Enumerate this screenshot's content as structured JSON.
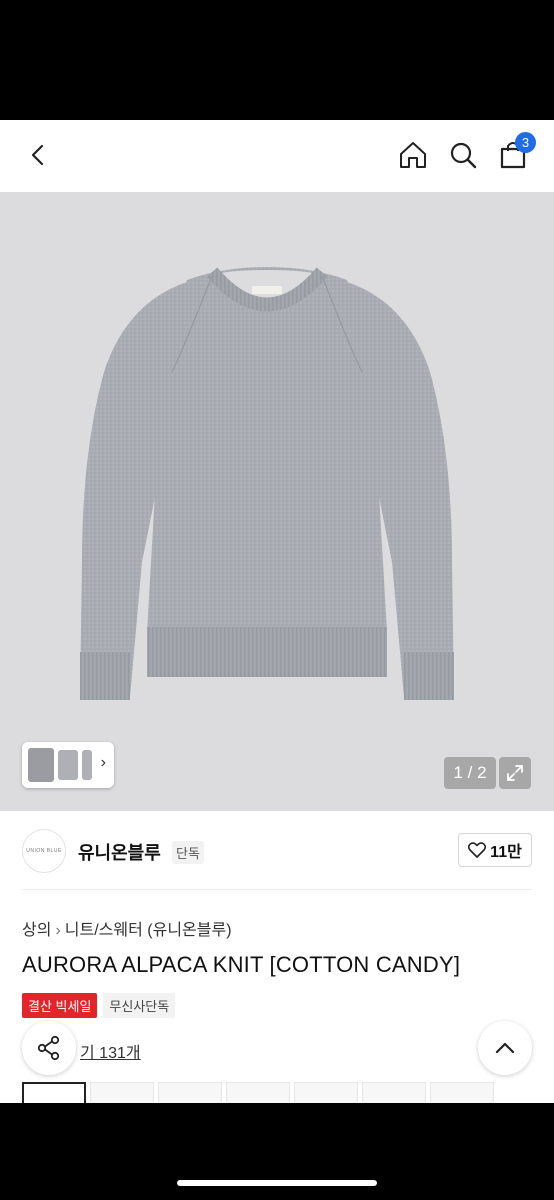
{
  "header": {
    "cart_count": "3"
  },
  "gallery": {
    "counter": "1 / 2"
  },
  "brand": {
    "logo_text": "UNION BLUE",
    "name": "유니온블루",
    "tag": "단독",
    "likes": "11만"
  },
  "breadcrumb": {
    "level1": "상의",
    "level2": "니트/스웨터",
    "level3": "(유니온블루)"
  },
  "product": {
    "title": "AURORA ALPACA KNIT [COTTON CANDY]",
    "tag_sale": "결산 빅세일",
    "tag_exclusive": "무신사단독",
    "review_text": "기 131개"
  },
  "colors": {
    "accent": "#1f6be8",
    "sale": "#e5232b",
    "hero_bg": "#dcdcde"
  },
  "icons": [
    "back-icon",
    "home-icon",
    "search-icon",
    "cart-icon",
    "expand-icon",
    "heart-icon",
    "share-icon",
    "chevron-up-icon",
    "chevron-right-icon"
  ]
}
